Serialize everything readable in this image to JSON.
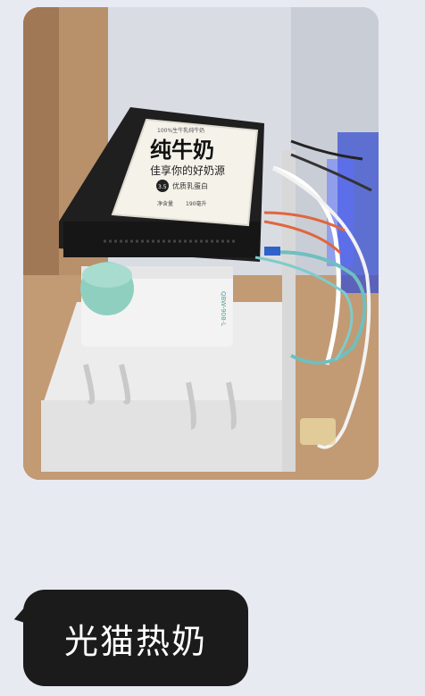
{
  "message": {
    "text": "光猫热奶"
  },
  "photo": {
    "milk_package": {
      "top_text": "100%生牛乳纯牛奶",
      "title": "纯牛奶",
      "subtitle": "佳享你的好奶源",
      "badge": "3.5",
      "brand": "优质乳蛋白",
      "footer_left": "净含量",
      "footer_right": "190毫升"
    },
    "router_label": "QBW-908-L"
  }
}
